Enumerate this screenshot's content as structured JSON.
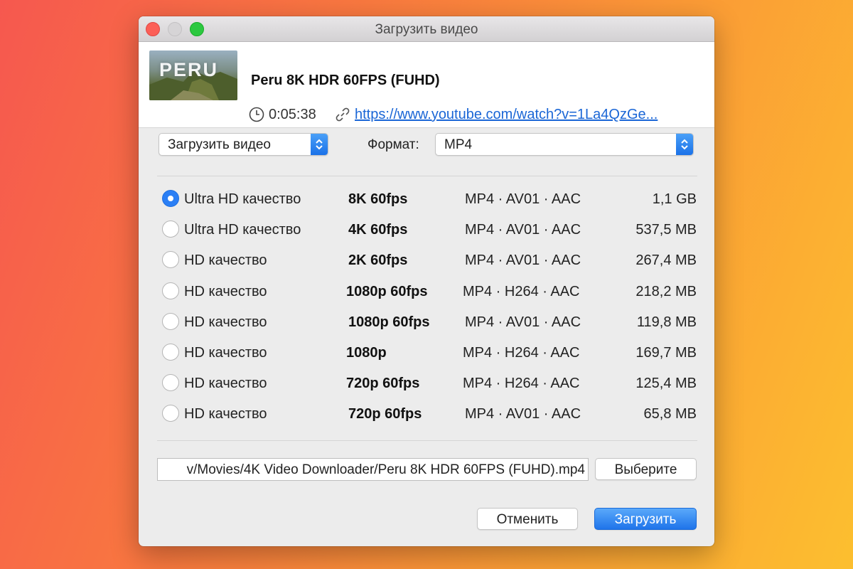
{
  "window": {
    "title": "Загрузить видео"
  },
  "video": {
    "title": "Peru 8K HDR 60FPS (FUHD)",
    "thumbnail_text": "PERU",
    "duration": "0:05:38",
    "url": "https://www.youtube.com/watch?v=1La4QzGe..."
  },
  "controls": {
    "action_select": "Загрузить видео",
    "format_label": "Формат:",
    "format_select": "MP4"
  },
  "options": [
    {
      "quality": "Ultra HD качество",
      "resolution": "8K 60fps",
      "codec": "MP4 · AV01 · AAC",
      "size": "1,1 GB",
      "selected": true
    },
    {
      "quality": "Ultra HD качество",
      "resolution": "4K 60fps",
      "codec": "MP4 · AV01 · AAC",
      "size": "537,5 MB",
      "selected": false
    },
    {
      "quality": "HD качество",
      "resolution": "2K 60fps",
      "codec": "MP4 · AV01 · AAC",
      "size": "267,4 MB",
      "selected": false
    },
    {
      "quality": "HD качество",
      "resolution": "1080p 60fps",
      "codec": "MP4 · H264 · AAC",
      "size": "218,2 MB",
      "selected": false
    },
    {
      "quality": "HD качество",
      "resolution": "1080p 60fps",
      "codec": "MP4 · AV01 · AAC",
      "size": "119,8 MB",
      "selected": false
    },
    {
      "quality": "HD качество",
      "resolution": "1080p",
      "codec": "MP4 · H264 · AAC",
      "size": "169,7 MB",
      "selected": false
    },
    {
      "quality": "HD качество",
      "resolution": "720p 60fps",
      "codec": "MP4 · H264 · AAC",
      "size": "125,4 MB",
      "selected": false
    },
    {
      "quality": "HD качество",
      "resolution": "720p 60fps",
      "codec": "MP4 · AV01 · AAC",
      "size": "65,8 MB",
      "selected": false
    }
  ],
  "save": {
    "path": "v/Movies/4K Video Downloader/Peru 8K HDR 60FPS (FUHD).mp4",
    "choose_label": "Выберите"
  },
  "footer": {
    "cancel_label": "Отменить",
    "download_label": "Загрузить"
  },
  "colors": {
    "accent": "#2b7ff5",
    "link": "#1a66d6"
  }
}
